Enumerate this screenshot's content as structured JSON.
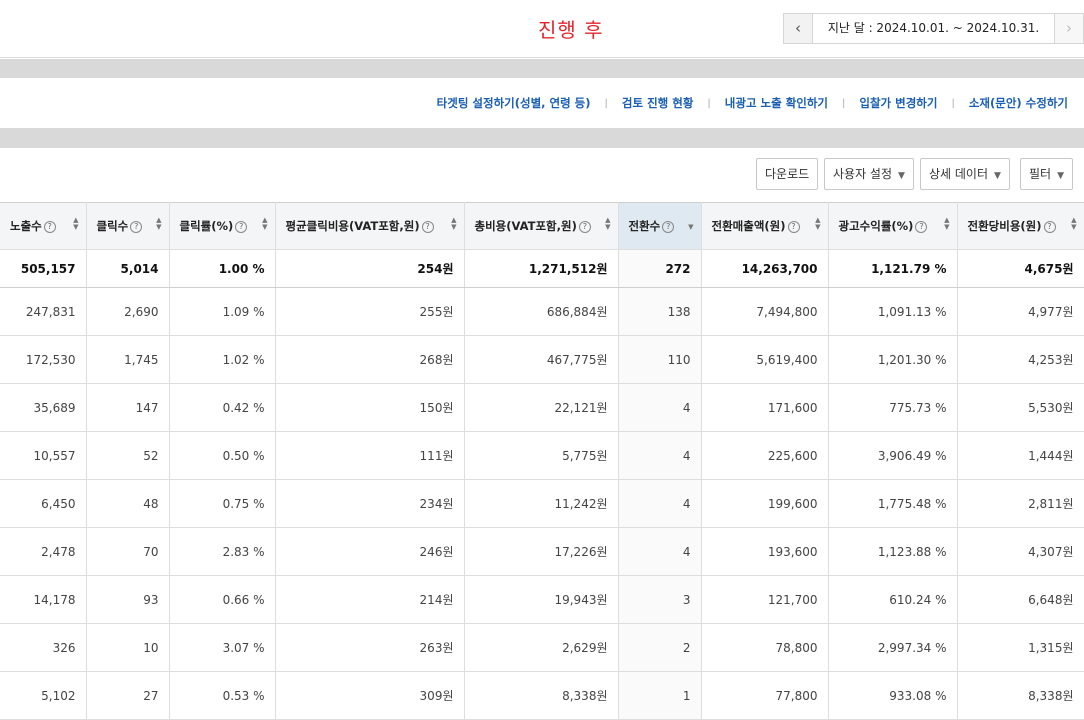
{
  "header": {
    "title": "진행 후",
    "period": {
      "prev_icon": "‹",
      "label": "지난 달 : 2024.10.01. ~ 2024.10.31.",
      "next_icon": "›"
    }
  },
  "links": [
    "타겟팅 설정하기(성별, 연령 등)",
    "검토 진행 현황",
    "내광고 노출 확인하기",
    "입찰가 변경하기",
    "소재(문안) 수정하기"
  ],
  "toolbar": {
    "download": "다운로드",
    "user_settings": "사용자 설정",
    "detail_data": "상세 데이터",
    "filter": "필터"
  },
  "table": {
    "columns": [
      {
        "label": "노출수",
        "help": true
      },
      {
        "label": "클릭수",
        "help": true
      },
      {
        "label": "클릭률(%)",
        "help": true
      },
      {
        "label": "평균클릭비용(VAT포함,원)",
        "help": true
      },
      {
        "label": "총비용(VAT포함,원)",
        "help": true
      },
      {
        "label": "전환수",
        "help": true,
        "active": true
      },
      {
        "label": "전환매출액(원)",
        "help": true
      },
      {
        "label": "광고수익률(%)",
        "help": true
      },
      {
        "label": "전환당비용(원)",
        "help": true
      }
    ],
    "total": [
      "505,157",
      "5,014",
      "1.00 %",
      "254원",
      "1,271,512원",
      "272",
      "14,263,700",
      "1,121.79 %",
      "4,675원"
    ],
    "rows": [
      [
        "247,831",
        "2,690",
        "1.09 %",
        "255원",
        "686,884원",
        "138",
        "7,494,800",
        "1,091.13 %",
        "4,977원"
      ],
      [
        "172,530",
        "1,745",
        "1.02 %",
        "268원",
        "467,775원",
        "110",
        "5,619,400",
        "1,201.30 %",
        "4,253원"
      ],
      [
        "35,689",
        "147",
        "0.42 %",
        "150원",
        "22,121원",
        "4",
        "171,600",
        "775.73 %",
        "5,530원"
      ],
      [
        "10,557",
        "52",
        "0.50 %",
        "111원",
        "5,775원",
        "4",
        "225,600",
        "3,906.49 %",
        "1,444원"
      ],
      [
        "6,450",
        "48",
        "0.75 %",
        "234원",
        "11,242원",
        "4",
        "199,600",
        "1,775.48 %",
        "2,811원"
      ],
      [
        "2,478",
        "70",
        "2.83 %",
        "246원",
        "17,226원",
        "4",
        "193,600",
        "1,123.88 %",
        "4,307원"
      ],
      [
        "14,178",
        "93",
        "0.66 %",
        "214원",
        "19,943원",
        "3",
        "121,700",
        "610.24 %",
        "6,648원"
      ],
      [
        "326",
        "10",
        "3.07 %",
        "263원",
        "2,629원",
        "2",
        "78,800",
        "2,997.34 %",
        "1,315원"
      ],
      [
        "5,102",
        "27",
        "0.53 %",
        "309원",
        "8,338원",
        "1",
        "77,800",
        "933.08 %",
        "8,338원"
      ]
    ]
  }
}
